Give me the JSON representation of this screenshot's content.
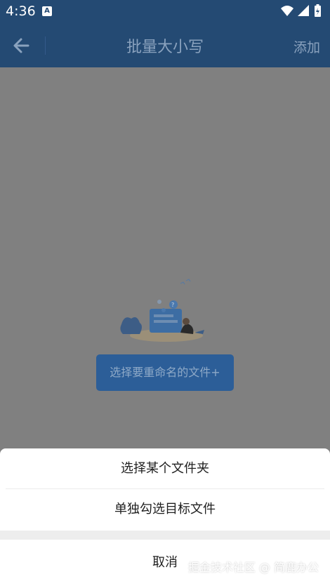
{
  "status_bar": {
    "time": "4:36",
    "notification_badge": "A",
    "icons": [
      "wifi-icon",
      "signal-icon",
      "battery-icon"
    ]
  },
  "app_bar": {
    "title": "批量大小写",
    "add_label": "添加",
    "back_icon": "arrow-left-icon"
  },
  "content": {
    "choose_button_label": "选择要重命名的文件+"
  },
  "sheet": {
    "options": [
      "选择某个文件夹",
      "单独勾选目标文件"
    ],
    "cancel_label": "取消"
  },
  "watermark": "掘金技术社区 @ 简鹿办公",
  "colors": {
    "primary": "#244a73",
    "button": "#2c5e98",
    "overlay_bg": "#808080"
  }
}
